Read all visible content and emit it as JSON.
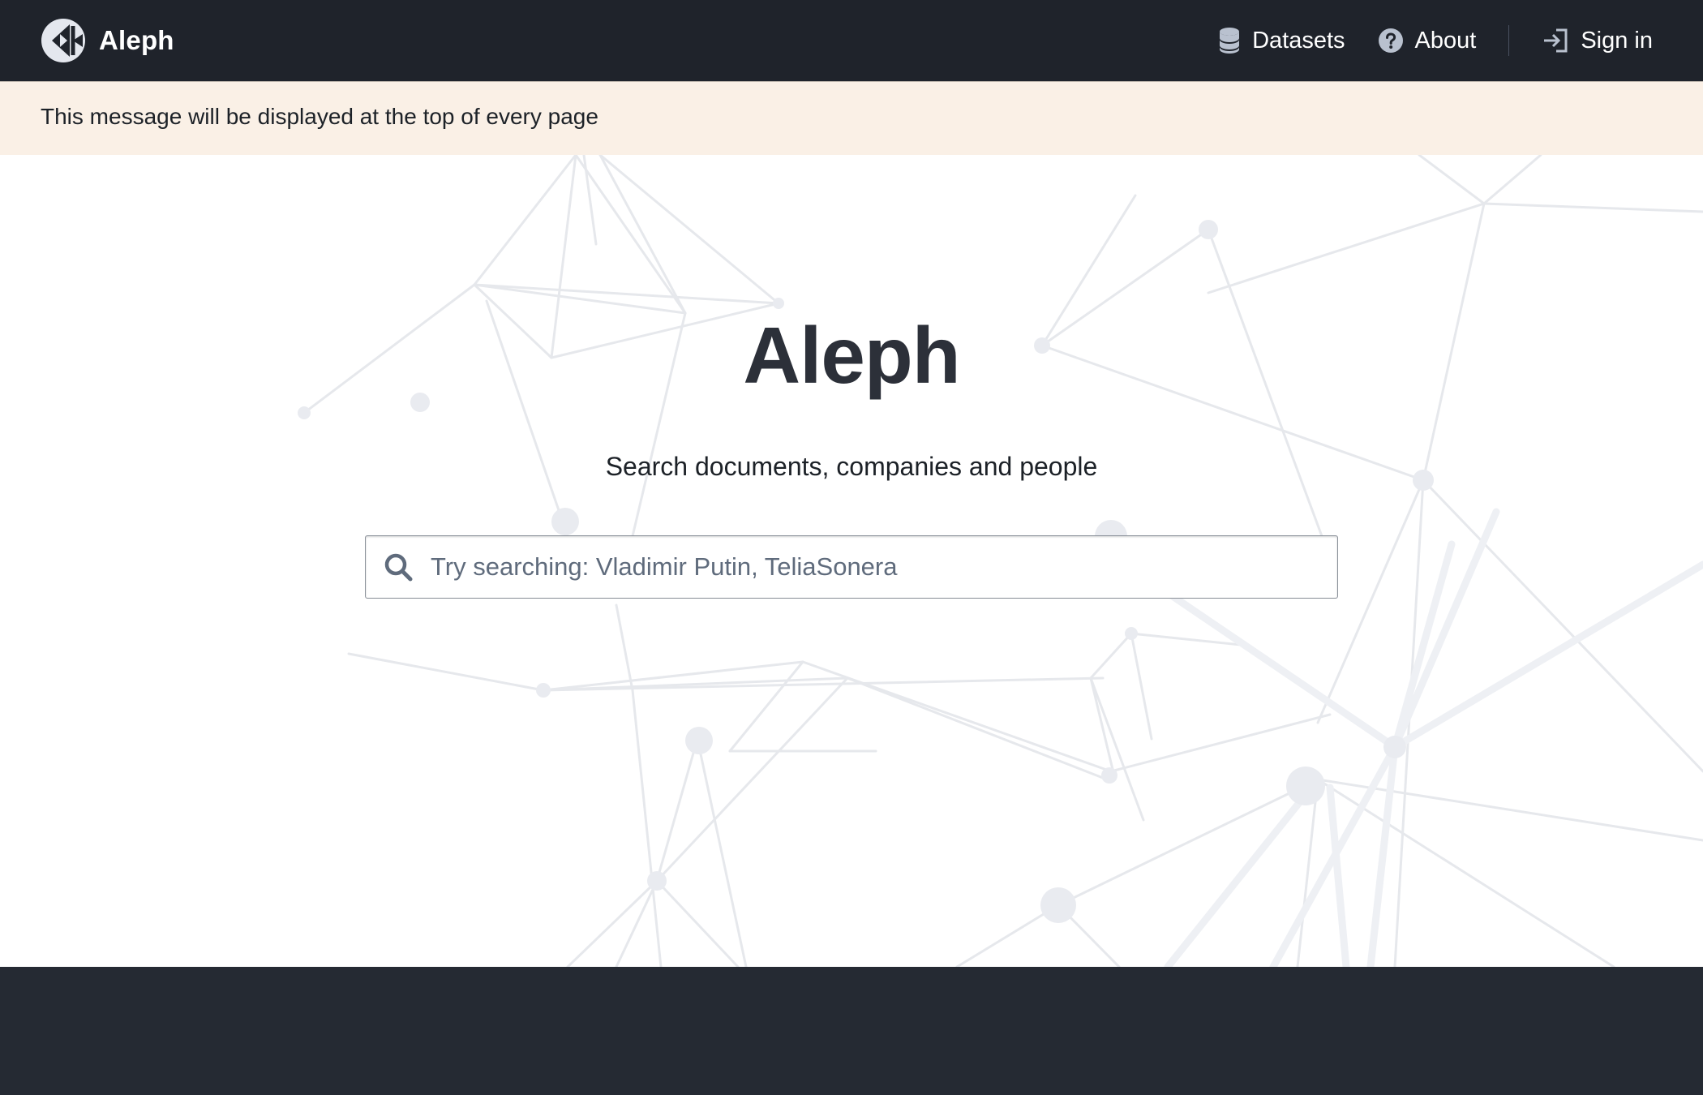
{
  "navbar": {
    "brand_name": "Aleph",
    "logo_icon": "aleph-logo-icon",
    "items": [
      {
        "label": "Datasets",
        "icon": "database-icon"
      },
      {
        "label": "About",
        "icon": "help-circle-icon"
      }
    ],
    "sign_in": {
      "label": "Sign in",
      "icon": "log-in-icon"
    }
  },
  "banner": {
    "message": "This message will be displayed at the top of every page"
  },
  "hero": {
    "title": "Aleph",
    "subtitle": "Search documents, companies and people",
    "search": {
      "placeholder": "Try searching: Vladimir Putin, TeliaSonera",
      "value": "",
      "icon": "search-icon"
    }
  },
  "colors": {
    "navbar_bg": "#1f232b",
    "banner_bg": "#faf0e6",
    "footer_bg": "#252a33",
    "title_text": "#2c3039"
  }
}
